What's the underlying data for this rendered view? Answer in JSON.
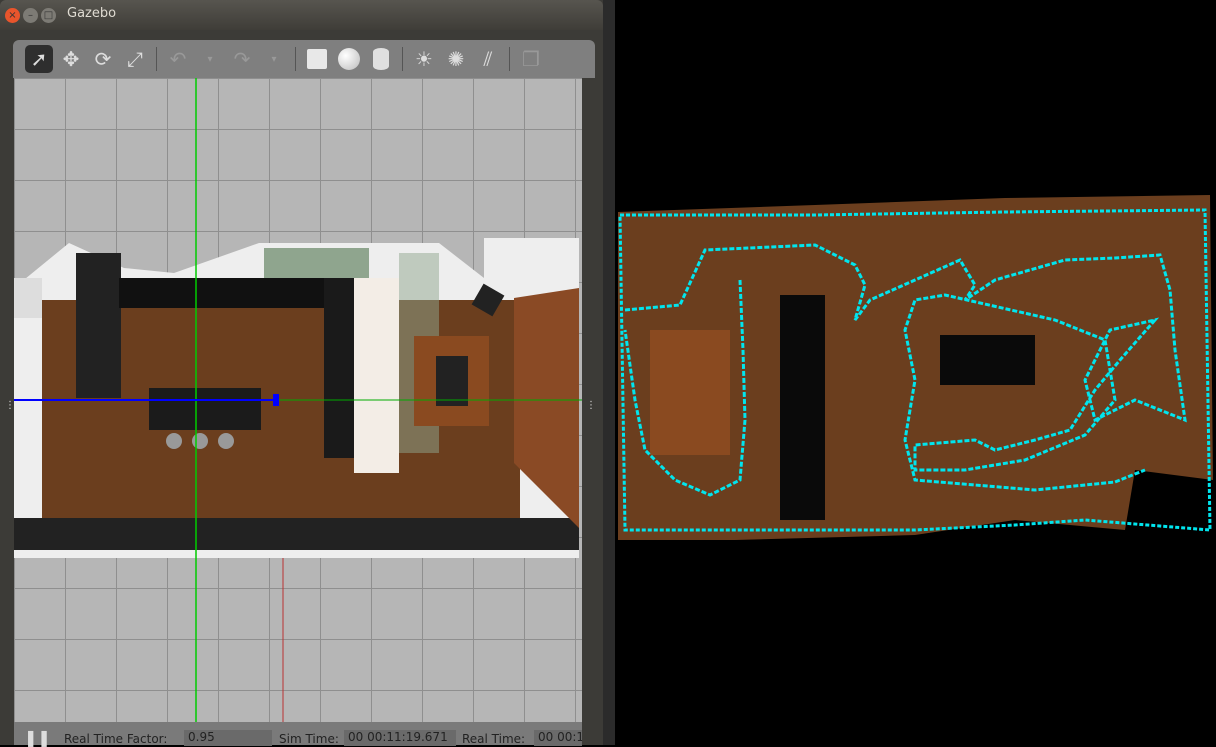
{
  "window": {
    "title": "Gazebo"
  },
  "toolbar": {
    "tools": [
      "select",
      "translate",
      "rotate",
      "scale",
      "undo",
      "redo",
      "box",
      "sphere",
      "cylinder",
      "point-light",
      "spot-light",
      "directional-light",
      "copy"
    ]
  },
  "status": {
    "rtf_label": "Real Time Factor:",
    "rtf_value": "0.95",
    "sim_label": "Sim Time:",
    "sim_value": "00 00:11:19.671",
    "real_label": "Real Time:",
    "real_value": "00 00:1"
  },
  "colors": {
    "path": "#00e5ee",
    "floor": "#6b3e1e",
    "axis_x": "#0000ff",
    "axis_y": "#00cc00"
  }
}
